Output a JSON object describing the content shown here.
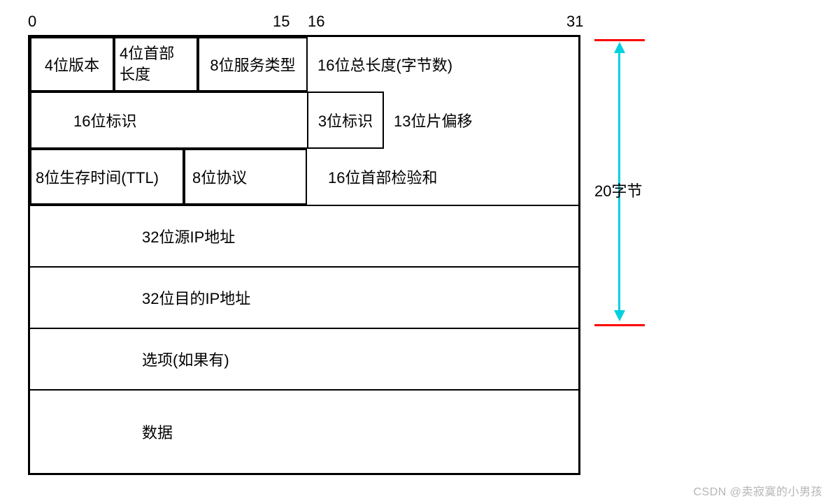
{
  "bit_labels": {
    "b0": "0",
    "b15": "15",
    "b16": "16",
    "b31": "31"
  },
  "fields": {
    "version": "4位版本",
    "hlen_a": "4位首部",
    "hlen_b": "长度",
    "tos": "8位服务类型",
    "total_len": "16位总长度(字节数)",
    "ident": "16位标识",
    "flags": "3位标识",
    "frag_offset": "13位片偏移",
    "ttl": "8位生存时间(TTL)",
    "protocol": "8位协议",
    "checksum": "16位首部检验和",
    "src_ip": "32位源IP地址",
    "dst_ip": "32位目的IP地址",
    "options": "选项(如果有)",
    "data": "数据"
  },
  "arrow": {
    "label": "20字节"
  },
  "watermark": "CSDN @卖寂寞的小男孩"
}
